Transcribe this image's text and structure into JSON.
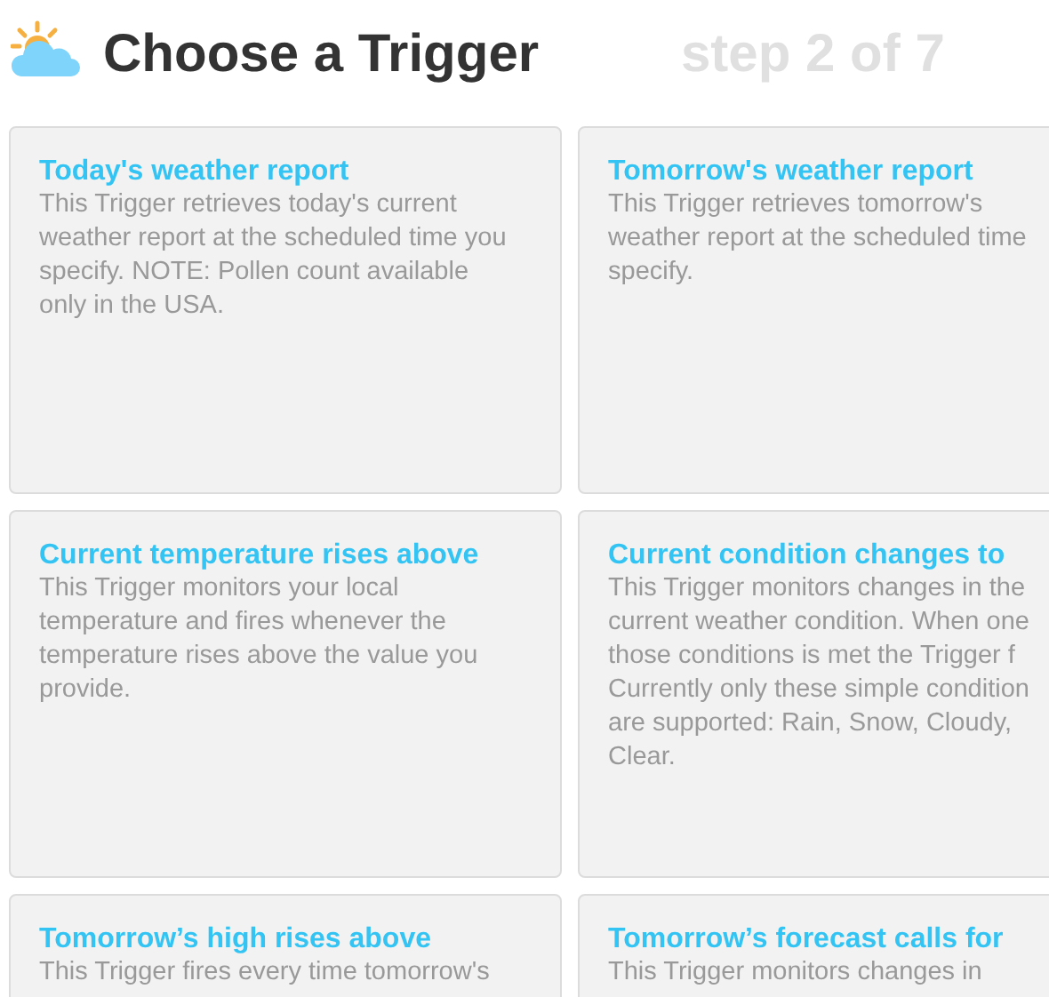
{
  "header": {
    "title": "Choose a Trigger",
    "step": "step 2 of 7"
  },
  "triggers": [
    {
      "title": "Today's weather report",
      "description": "This Trigger retrieves today's current\nweather report at the scheduled time you\nspecify. NOTE: Pollen count available\nonly in the USA."
    },
    {
      "title": "Tomorrow's weather report",
      "description": "This Trigger retrieves tomorrow's\nweather report at the scheduled time\nspecify."
    },
    {
      "title": "Current temperature rises above",
      "description": "This Trigger monitors your local\ntemperature and fires whenever the\ntemperature rises above the value you\nprovide."
    },
    {
      "title": "Current condition changes to",
      "description": "This Trigger monitors changes in the\ncurrent weather condition. When one\nthose conditions is met the Trigger f\nCurrently only these simple condition\nare supported: Rain, Snow, Cloudy,\nClear."
    },
    {
      "title": "Tomorrow’s high rises above",
      "description": "This Trigger fires every time tomorrow's"
    },
    {
      "title": "Tomorrow’s forecast calls for",
      "description": "This Trigger monitors changes in"
    }
  ]
}
